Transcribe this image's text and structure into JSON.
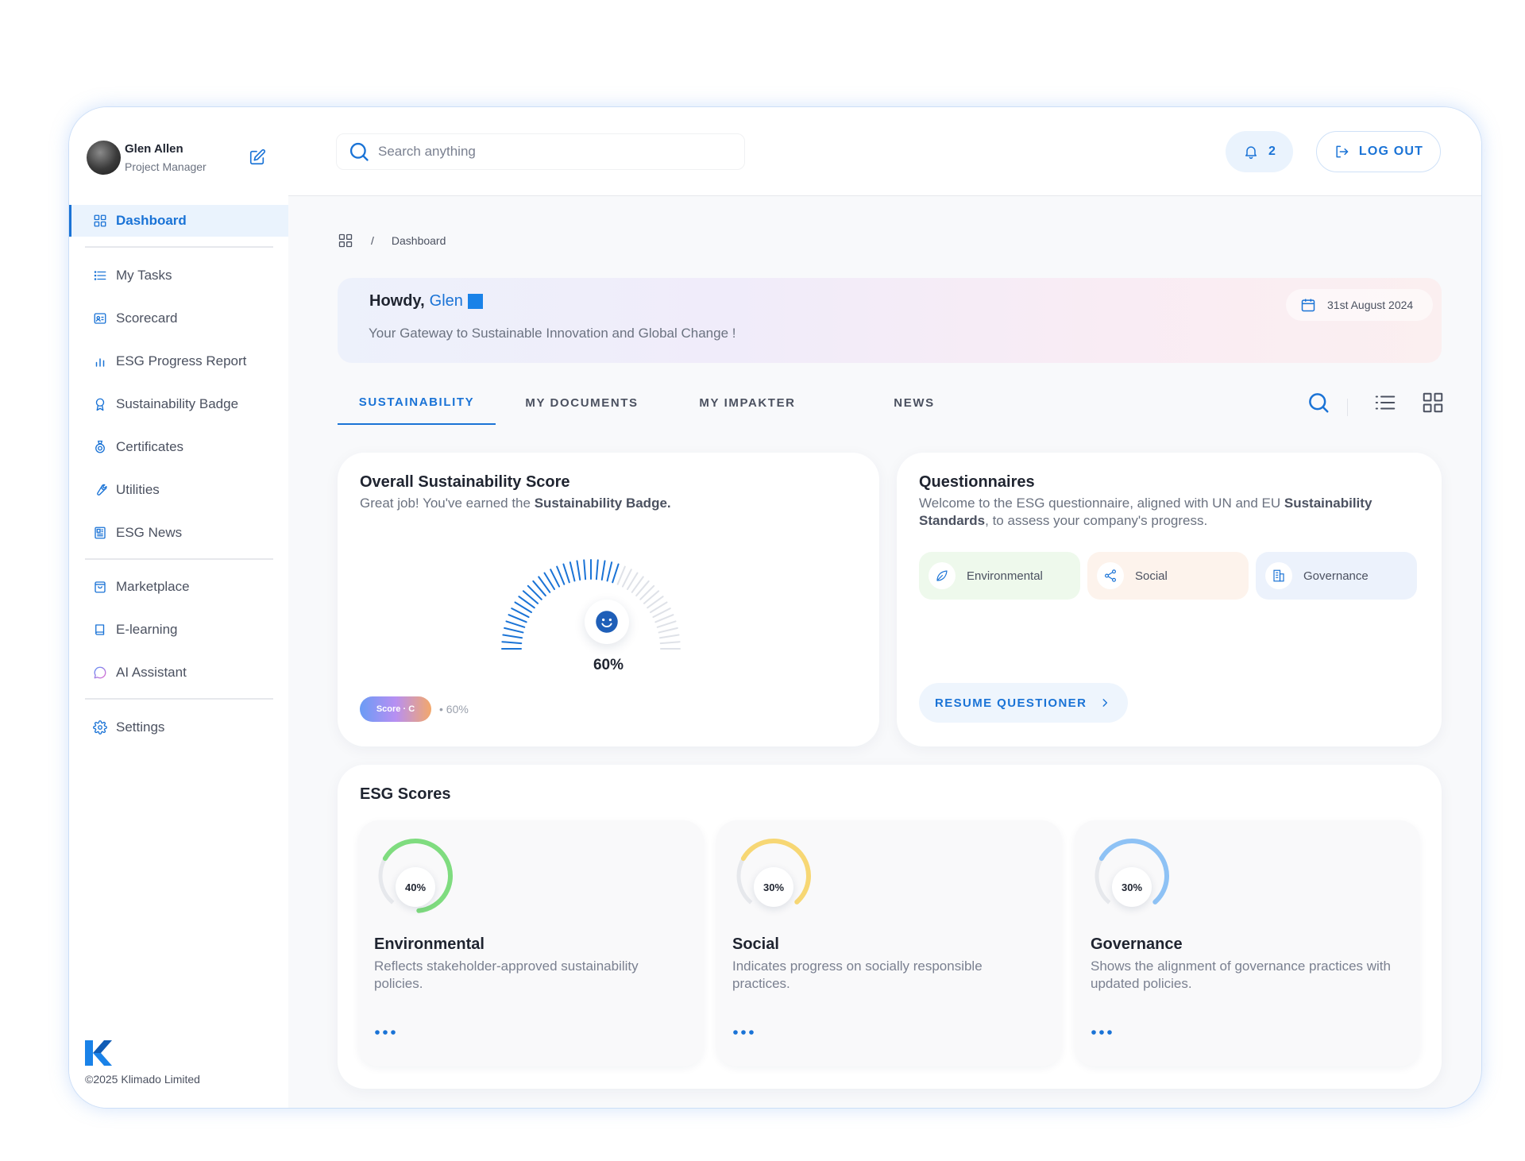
{
  "profile": {
    "name": "Glen Allen",
    "role": "Project Manager"
  },
  "sidebar": {
    "items": [
      {
        "label": "Dashboard",
        "icon": "grid-icon",
        "active": true
      },
      {
        "label": "My Tasks",
        "icon": "list-icon"
      },
      {
        "label": "Scorecard",
        "icon": "id-card-icon"
      },
      {
        "label": "ESG Progress Report",
        "icon": "bar-chart-icon"
      },
      {
        "label": "Sustainability Badge",
        "icon": "badge-icon"
      },
      {
        "label": "Certificates",
        "icon": "certificate-icon"
      },
      {
        "label": "Utilities",
        "icon": "wrench-icon"
      },
      {
        "label": "ESG News",
        "icon": "newspaper-icon"
      },
      {
        "label": "Marketplace",
        "icon": "shopping-bag-icon"
      },
      {
        "label": "E-learning",
        "icon": "book-icon"
      },
      {
        "label": "AI Assistant",
        "icon": "chat-bubble-icon"
      },
      {
        "label": "Settings",
        "icon": "gear-icon"
      }
    ],
    "copyright": "©2025 Klimado Limited"
  },
  "topbar": {
    "search_placeholder": "Search anything",
    "notification_count": "2",
    "logout_label": "LOG OUT"
  },
  "breadcrumb": {
    "current": "Dashboard",
    "separator": "/"
  },
  "welcome": {
    "greeting": "Howdy,",
    "name": "Glen",
    "subtitle": "Your Gateway to Sustainable Innovation and Global Change !",
    "date": "31st August 2024"
  },
  "tabs": [
    {
      "label": "SUSTAINABILITY",
      "active": true
    },
    {
      "label": "MY DOCUMENTS"
    },
    {
      "label": "MY IMPAKTER"
    },
    {
      "label": "NEWS"
    }
  ],
  "score_card": {
    "title": "Overall Sustainability Score",
    "subtitle_prefix": "Great job! You've earned the ",
    "subtitle_bold": "Sustainability Badge.",
    "value": "60%",
    "value_fraction": 0.6,
    "badge_label": "Score  · C",
    "badge_note": "60%"
  },
  "questionnaires": {
    "title": "Questionnaires",
    "desc_1": "Welcome to the ESG questionnaire, aligned with UN and EU ",
    "desc_bold": "Sustainability Standards",
    "desc_2": ", to assess your company's progress.",
    "chips": [
      {
        "label": "Environmental",
        "icon": "leaf-icon",
        "color": "#eef9ec"
      },
      {
        "label": "Social",
        "icon": "share-icon",
        "color": "#fdf3ec"
      },
      {
        "label": "Governance",
        "icon": "building-icon",
        "color": "#ecf2fc"
      }
    ],
    "resume_label": "RESUME QUESTIONER"
  },
  "esg_scores": {
    "title": "ESG Scores",
    "items": [
      {
        "label": "Environmental",
        "percent": "40%",
        "fraction": 0.4,
        "color": "#7fdc7f",
        "desc": "Reflects stakeholder-approved sustainability policies."
      },
      {
        "label": "Social",
        "percent": "30%",
        "fraction": 0.3,
        "color": "#f7d774",
        "desc": "Indicates progress on socially responsible practices."
      },
      {
        "label": "Governance",
        "percent": "30%",
        "fraction": 0.3,
        "color": "#8ec2f5",
        "desc": "Shows the alignment of governance practices with updated policies."
      }
    ]
  },
  "colors": {
    "accent": "#1a73d6"
  }
}
